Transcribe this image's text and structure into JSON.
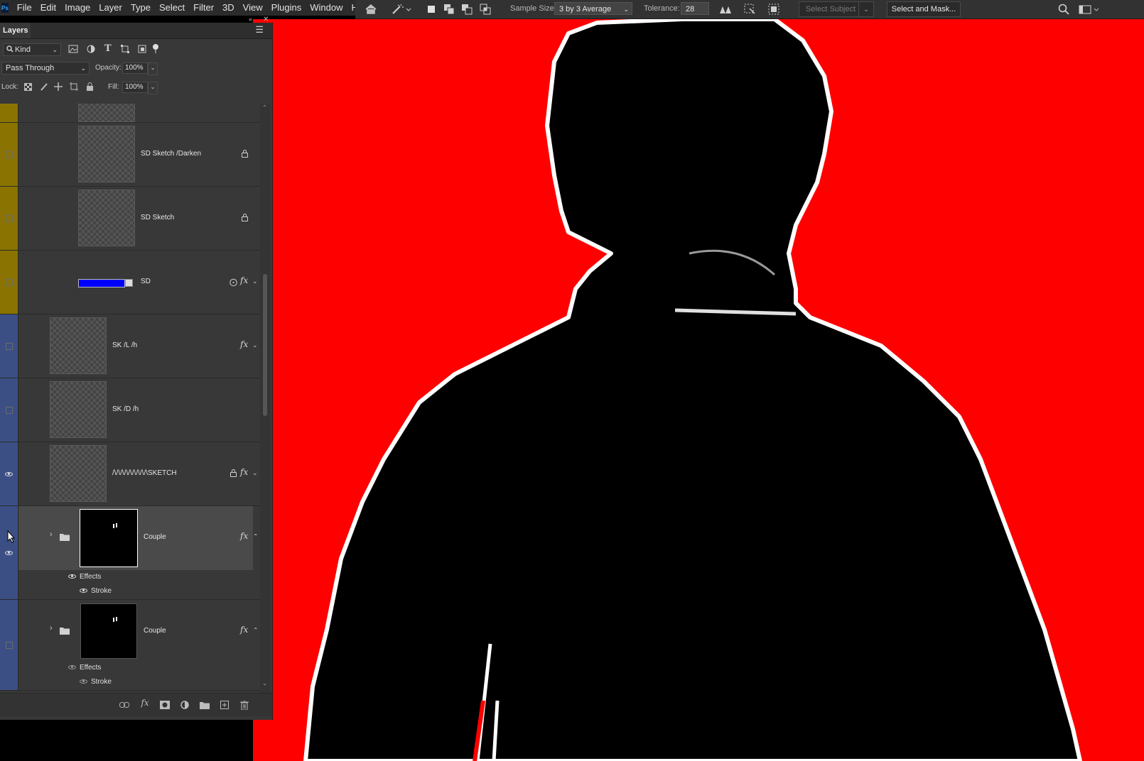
{
  "menubar": {
    "items": [
      "File",
      "Edit",
      "Image",
      "Layer",
      "Type",
      "Select",
      "Filter",
      "3D",
      "View",
      "Plugins",
      "Window",
      "Help"
    ]
  },
  "options_bar": {
    "icons": [
      "home-icon",
      "magic-wand-icon",
      "new-selection-icon",
      "add-selection-icon",
      "subtract-selection-icon",
      "intersect-selection-icon"
    ],
    "sample_size_label": "Sample Size:",
    "sample_size_value": "3 by 3 Average",
    "tolerance_label": "Tolerance:",
    "tolerance_value": "28",
    "select_subject_label": "Select Subject",
    "select_and_mask_label": "Select and Mask..."
  },
  "panel": {
    "title": "Layers",
    "filter_kind": "Kind",
    "blend_mode": "Pass Through",
    "opacity_label": "Opacity:",
    "opacity_value": "100%",
    "lock_label": "Lock:",
    "fill_label": "Fill:",
    "fill_value": "100%"
  },
  "layers": [
    {
      "name": "",
      "color": "#8a7300",
      "visible": false,
      "partial": true
    },
    {
      "name": "SD Sketch /Darken",
      "color": "#8a7300",
      "visible": false,
      "locked": true
    },
    {
      "name": "SD Sketch",
      "color": "#8a7300",
      "visible": false,
      "locked": true
    },
    {
      "name": "SD",
      "color": "#8a7300",
      "visible": false,
      "fill_color": "#0000ff",
      "fx": true
    },
    {
      "name": "SK /L /h",
      "color": "#3c4f85",
      "visible": false,
      "fx": true
    },
    {
      "name": "SK /D /h",
      "color": "#3c4f85",
      "visible": false
    },
    {
      "name": "/\\/\\/\\/\\/\\/\\/\\/\\/\\SKETCH",
      "color": "#3c4f85",
      "visible": true,
      "locked": true,
      "fx": true
    },
    {
      "name": "Couple",
      "color": "#3c4f85",
      "visible": true,
      "group": true,
      "fx": true,
      "selected": true,
      "effects": [
        "Effects",
        "Stroke"
      ]
    },
    {
      "name": "Couple",
      "color": "#3c4f85",
      "visible": false,
      "group": true,
      "fx": true,
      "effects": [
        "Effects",
        "Stroke"
      ]
    }
  ],
  "fx_label": "fx",
  "bottom_bar_icons": [
    "link-icon",
    "fx-icon",
    "mask-icon",
    "adjustment-icon",
    "group-folder-icon",
    "new-layer-icon",
    "trash-icon"
  ],
  "canvas": {
    "background": "#ff0000",
    "subject": "black silhouette with white outline"
  }
}
